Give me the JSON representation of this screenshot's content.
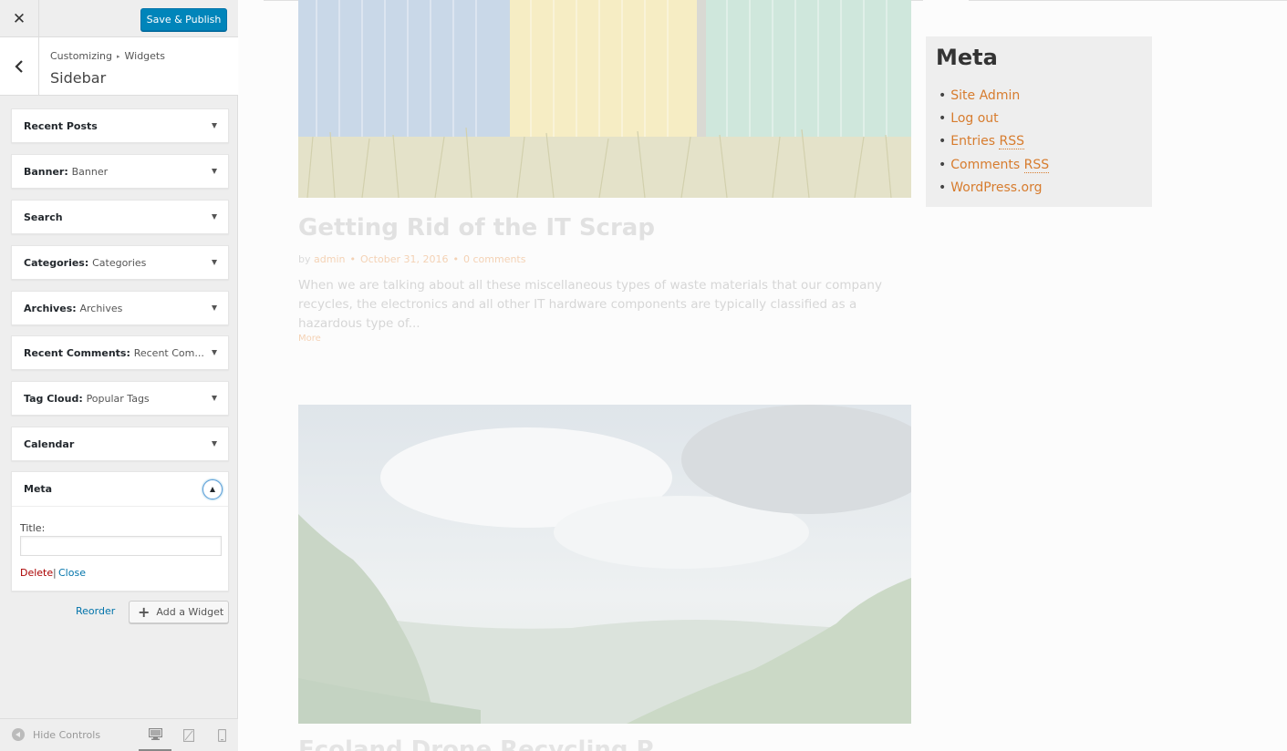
{
  "colors": {
    "accent": "#0085ba",
    "link": "#0073aa",
    "danger": "#a00000",
    "theme_link": "#d77c2e"
  },
  "topbar": {
    "close_icon": "close-icon",
    "save_label": "Save & Publish"
  },
  "section": {
    "back_icon": "chevron-left-icon",
    "breadcrumb": [
      "Customizing",
      "Widgets"
    ],
    "title": "Sidebar"
  },
  "widgets": [
    {
      "name": "Recent Posts",
      "subtitle": ""
    },
    {
      "name": "Banner",
      "subtitle": "Banner"
    },
    {
      "name": "Search",
      "subtitle": ""
    },
    {
      "name": "Categories",
      "subtitle": "Categories"
    },
    {
      "name": "Archives",
      "subtitle": "Archives"
    },
    {
      "name": "Recent Comments",
      "subtitle": "Recent Com..."
    },
    {
      "name": "Tag Cloud",
      "subtitle": "Popular Tags"
    },
    {
      "name": "Calendar",
      "subtitle": ""
    }
  ],
  "meta_widget": {
    "name": "Meta",
    "title_label": "Title:",
    "title_value": "",
    "delete_label": "Delete",
    "separator": "|",
    "close_label": "Close"
  },
  "actions": {
    "reorder_label": "Reorder",
    "add_widget_label": "Add a Widget"
  },
  "footer": {
    "hide_controls_label": "Hide Controls",
    "devices": [
      "desktop-icon",
      "tablet-icon",
      "mobile-icon"
    ]
  },
  "preview": {
    "post": {
      "title": "Getting Rid of the IT Scrap",
      "by_label": "by",
      "author": "admin",
      "date": "October 31, 2016",
      "comments": "0 comments",
      "excerpt": "When we are talking about all these miscellaneous types of waste materials that our company recycles, the electronics and all other IT hardware components are typically classified as a hazardous type of...",
      "more_label": "More"
    },
    "next_post_title": "Ecoland Drone Recycling P...",
    "sidebar_meta": {
      "heading": "Meta",
      "links": [
        {
          "text": "Site Admin",
          "abbr": ""
        },
        {
          "text": "Log out",
          "abbr": ""
        },
        {
          "text": "Entries ",
          "abbr": "RSS"
        },
        {
          "text": "Comments ",
          "abbr": "RSS"
        },
        {
          "text": "WordPress.org",
          "abbr": ""
        }
      ]
    }
  }
}
